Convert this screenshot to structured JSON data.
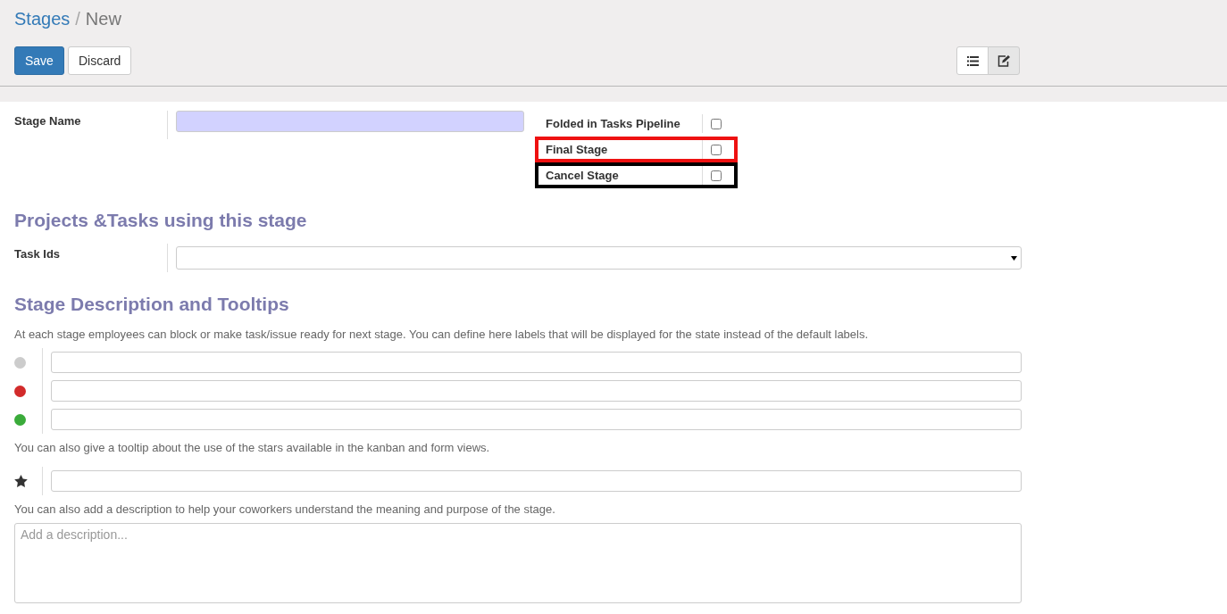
{
  "breadcrumb": {
    "parent": "Stages",
    "separator": "/",
    "current": "New"
  },
  "buttons": [
    {
      "label": "Save",
      "kind": "primary"
    },
    {
      "label": "Discard",
      "kind": "default"
    }
  ],
  "view_switcher": [
    {
      "kind": "list",
      "selected": false
    },
    {
      "kind": "form",
      "selected": true
    }
  ],
  "stage_name": {
    "label": "Stage Name",
    "focused": true
  },
  "flags": [
    {
      "label": "Folded in Tasks Pipeline",
      "checked": false
    },
    {
      "label": "Final Stage",
      "checked": false,
      "color": "#ee1111"
    },
    {
      "label": "Cancel Stage",
      "checked": false,
      "color": "#000000"
    }
  ],
  "projects_section": {
    "title": "Projects &Tasks using this stage",
    "field_label": "Task Ids"
  },
  "description_section": {
    "title": "Stage Description and Tooltips",
    "intro": "At each stage employees can block or make task/issue ready for next stage. You can define here labels that will be displayed for the state instead of the default labels.",
    "legends": [
      {
        "kind": "dot",
        "color": "#cccccc"
      },
      {
        "kind": "dot",
        "color": "#d22b2b"
      },
      {
        "kind": "dot",
        "color": "#3aab3a"
      }
    ],
    "stars_note": "You can also give a tooltip about the use of the stars available in the kanban and form views.",
    "star_legend": {
      "kind": "star"
    },
    "description_note": "You can also add a description to help your coworkers understand the meaning and purpose of the stage.",
    "description_placeholder": "Add a description..."
  }
}
